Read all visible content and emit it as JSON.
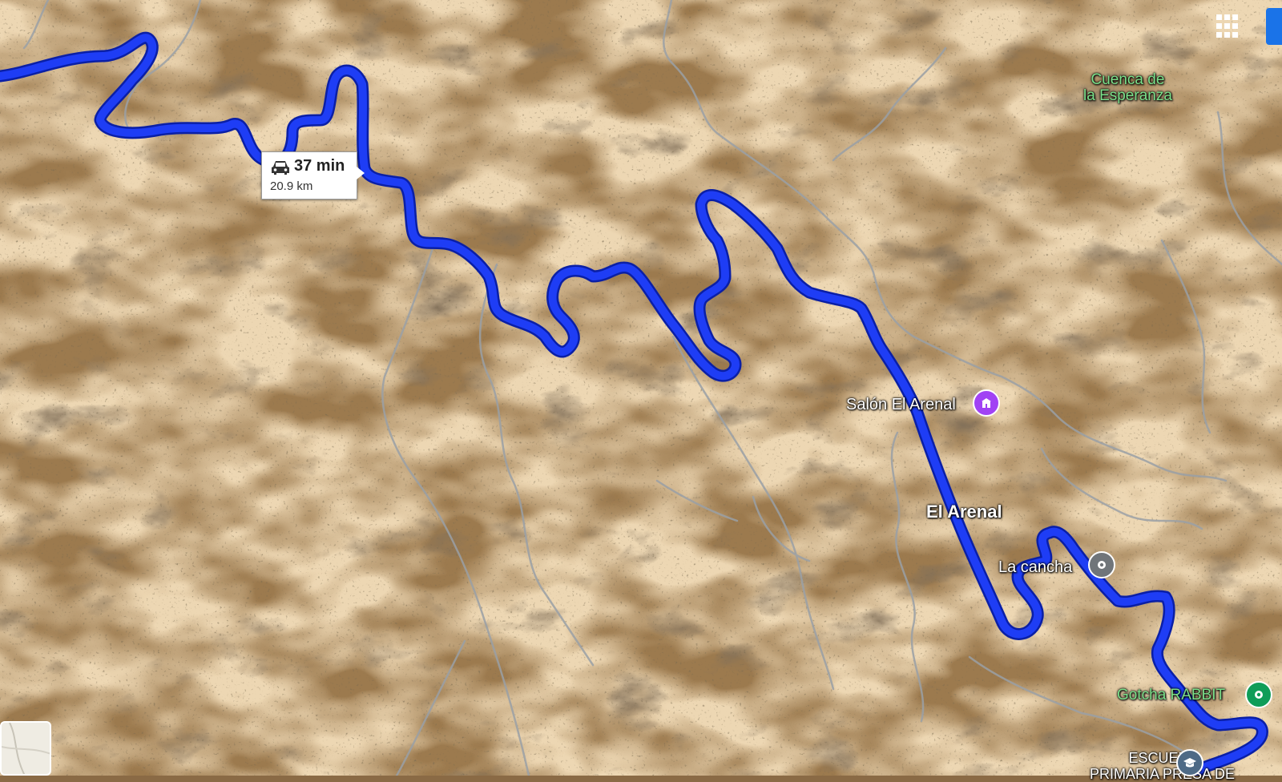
{
  "route": {
    "time": "37 min",
    "distance": "20.9 km",
    "color": "#1e3df5"
  },
  "places": {
    "salon": "Salón El Arenal",
    "town": "El Arenal",
    "cancha": "La cancha",
    "cuenca_line1": "Cuenca de",
    "cuenca_line2": "la Esperanza",
    "gotcha": "Gotcha RABBIT",
    "escuela_line1": "ESCUELA",
    "escuela_line2": "PRIMARIA PRESA DE"
  },
  "icons": {
    "salon": "event-venue-icon",
    "cancha": "location-pin-icon",
    "gotcha": "place-pin-icon",
    "escuela": "school-icon",
    "car": "car-icon",
    "apps": "apps-grid-icon"
  },
  "colors": {
    "salon_pin": "#a142f4",
    "cancha_pin": "#70757a",
    "gotcha_pin": "#0f9d58",
    "escuela_pin": "#4e6a86",
    "park_label": "#7be08a"
  }
}
